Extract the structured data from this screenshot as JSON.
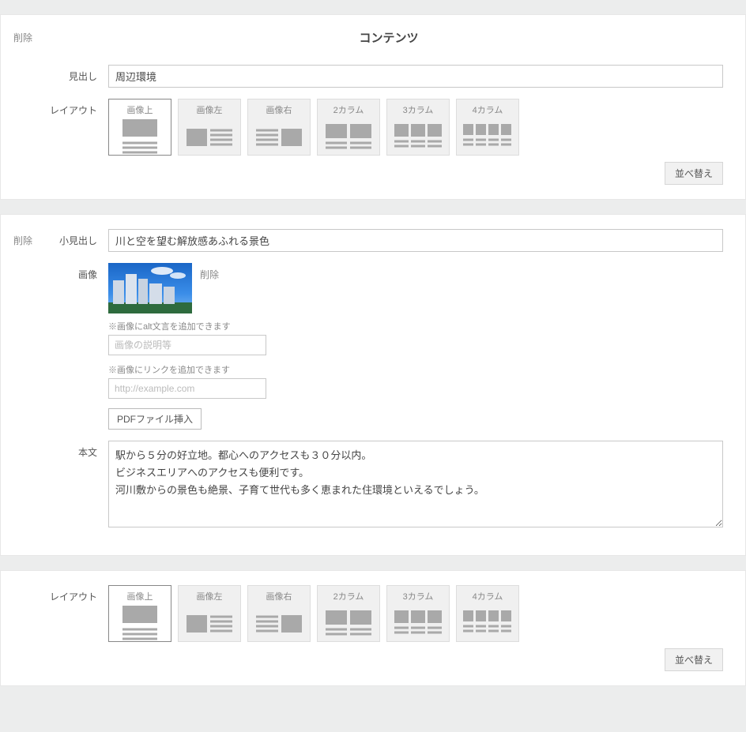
{
  "header": {
    "delete_label": "削除",
    "section_title": "コンテンツ"
  },
  "labels": {
    "heading": "見出し",
    "layout": "レイアウト",
    "subheading": "小見出し",
    "image": "画像",
    "body": "本文"
  },
  "heading_value": "周辺環境",
  "layout_options": [
    {
      "key": "image_top",
      "label": "画像上"
    },
    {
      "key": "image_left",
      "label": "画像左"
    },
    {
      "key": "image_right",
      "label": "画像右"
    },
    {
      "key": "col2",
      "label": "2カラム"
    },
    {
      "key": "col3",
      "label": "3カラム"
    },
    {
      "key": "col4",
      "label": "4カラム"
    }
  ],
  "reorder_label": "並べ替え",
  "block": {
    "delete_label": "削除",
    "subheading_value": "川と空を望む解放感あふれる景色",
    "image_delete_label": "削除",
    "alt_helper": "※画像にalt文言を追加できます",
    "alt_placeholder": "画像の説明等",
    "link_helper": "※画像にリンクを追加できます",
    "link_placeholder": "http://example.com",
    "pdf_button": "PDFファイル挿入",
    "body_value": "駅から５分の好立地。都心へのアクセスも３０分以内。\nビジネスエリアへのアクセスも便利です。\n河川敷からの景色も絶景、子育て世代も多く恵まれた住環境といえるでしょう。"
  }
}
